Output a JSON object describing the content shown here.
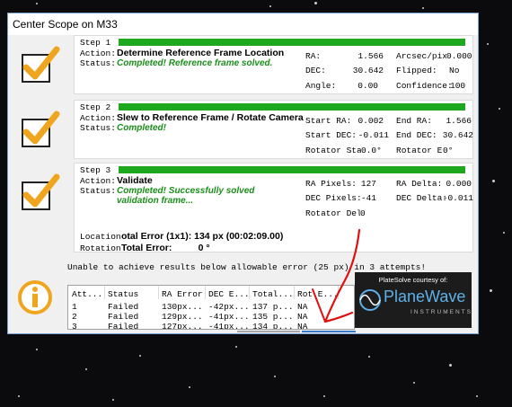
{
  "window": {
    "title": "Center Scope on M33"
  },
  "labels": {
    "action": "Action:",
    "status": "Status:"
  },
  "steps": [
    {
      "name": "Step 1",
      "action": "Determine Reference Frame Location",
      "status": "Completed!  Reference frame solved.",
      "fields": [
        {
          "label": "RA:",
          "value": "1.566"
        },
        {
          "label": "DEC:",
          "value": "30.642"
        },
        {
          "label": "Angle:",
          "value": "0.00"
        },
        {
          "label": "Arcsec/pixel",
          "value": "0.000"
        },
        {
          "label": "Flipped:",
          "value": "No"
        },
        {
          "label": "Confidence:",
          "value": "100"
        }
      ]
    },
    {
      "name": "Step 2",
      "action": "Slew to Reference Frame / Rotate Camera",
      "status": "Completed!",
      "fields": [
        {
          "label": "Start RA:",
          "value": "0.002"
        },
        {
          "label": "Start DEC:",
          "value": "-0.011"
        },
        {
          "label": "Rotator Start",
          "value": "0.0°"
        },
        {
          "label": "End RA:",
          "value": "1.566"
        },
        {
          "label": "End DEC:",
          "value": "30.642"
        },
        {
          "label": "Rotator End",
          "value": "0°"
        }
      ]
    },
    {
      "name": "Step 3",
      "action": "Validate",
      "status": "Completed!  Successfully solved validation frame...",
      "fields": [
        {
          "label": "RA Pixels:",
          "value": "127"
        },
        {
          "label": "DEC Pixels:",
          "value": "-41"
        },
        {
          "label": "Rotator Delta",
          "value": "0"
        },
        {
          "label": "RA Delta:",
          "value": "0.000"
        },
        {
          "label": "DEC Delta:",
          "value": "-0.011"
        }
      ],
      "location_label": "Location:",
      "location_value": "otal Error (1x1):  134 px    (00:02:09.00)",
      "rotation_label": "Rotation:",
      "rotation_value": "Total Error:          0 °"
    }
  ],
  "message": "Unable to achieve results below allowable error (25 px) in 3 attempts!",
  "results_table": {
    "columns": [
      "Att...",
      "Status",
      "RA Error",
      "DEC E...",
      "Total...",
      "Rot E..."
    ],
    "rows": [
      [
        "1",
        "Failed",
        "130px...",
        "-42px...",
        "137 p...",
        "NA"
      ],
      [
        "2",
        "Failed",
        "129px...",
        "-41px...",
        "135 p...",
        "NA"
      ],
      [
        "3",
        "Failed",
        "127px...",
        "-41px...",
        "134 p...",
        "NA"
      ]
    ]
  },
  "logo": {
    "credit": "PlateSolve courtesy of:",
    "brand": "PlaneWave",
    "subtitle": "INSTRUMENTS"
  },
  "colors": {
    "progress": "#1ea81e",
    "status_text": "#1a8f1a",
    "check": "#f0a51e",
    "info": "#f0a51e",
    "annotation": "#e01010",
    "logo_text": "#5fb0e8"
  }
}
